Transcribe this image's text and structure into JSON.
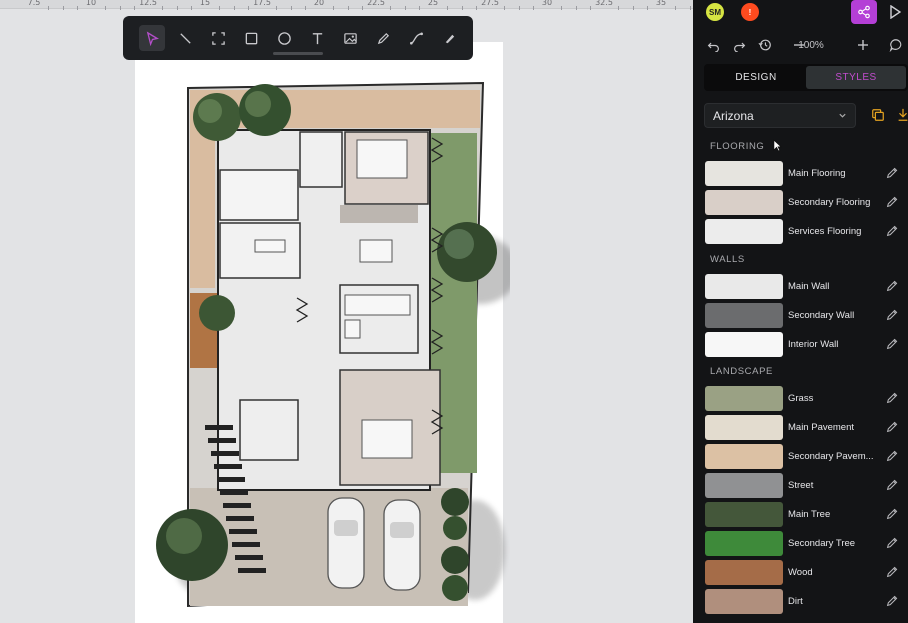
{
  "ruler": {
    "ticks": [
      "7.5",
      "10",
      "12.5",
      "15",
      "17.5",
      "20",
      "22.5",
      "25",
      "27.5",
      "30",
      "32.5",
      "35"
    ]
  },
  "toolbar": {
    "tools": [
      {
        "name": "select-tool",
        "icon": "cursor-icon",
        "active": true
      },
      {
        "name": "line-tool",
        "icon": "line-icon"
      },
      {
        "name": "frame-tool",
        "icon": "frame-icon"
      },
      {
        "name": "rectangle-tool",
        "icon": "square-icon"
      },
      {
        "name": "ellipse-tool",
        "icon": "circle-icon"
      },
      {
        "name": "text-tool",
        "icon": "text-icon",
        "glyph": "T"
      },
      {
        "name": "image-tool",
        "icon": "image-icon"
      },
      {
        "name": "pen-tool",
        "icon": "pen-icon"
      },
      {
        "name": "curve-tool",
        "icon": "curve-icon"
      },
      {
        "name": "brush-tool",
        "icon": "brush-icon"
      }
    ]
  },
  "header": {
    "avatars": [
      {
        "initials": "SM",
        "color": "#d6e442"
      },
      {
        "initials": "!",
        "color": "#ff4b1f"
      }
    ],
    "zoom": "100%"
  },
  "tabs": {
    "design": "DESIGN",
    "styles": "STYLES"
  },
  "style_select": {
    "value": "Arizona"
  },
  "sections": {
    "flooring": {
      "title": "FLOORING",
      "items": [
        {
          "label": "Main Flooring",
          "color": "#e6e4df"
        },
        {
          "label": "Secondary Flooring",
          "color": "#d9cfc8"
        },
        {
          "label": "Services Flooring",
          "color": "#ececec"
        }
      ]
    },
    "walls": {
      "title": "WALLS",
      "items": [
        {
          "label": "Main Wall",
          "color": "#e9e9e9"
        },
        {
          "label": "Secondary Wall",
          "color": "#6b6c6e"
        },
        {
          "label": "Interior Wall",
          "color": "#f7f7f7"
        }
      ]
    },
    "landscape": {
      "title": "LANDSCAPE",
      "items": [
        {
          "label": "Grass",
          "color": "#9aa184"
        },
        {
          "label": "Main Pavement",
          "color": "#e3dccf"
        },
        {
          "label": "Secondary Pavem...",
          "color": "#dcc1a4"
        },
        {
          "label": "Street",
          "color": "#909193"
        },
        {
          "label": "Main Tree",
          "color": "#44573a"
        },
        {
          "label": "Secondary Tree",
          "color": "#3e8a3a"
        },
        {
          "label": "Wood",
          "color": "#a56c48"
        },
        {
          "label": "Dirt",
          "color": "#b08f7d"
        }
      ]
    }
  }
}
